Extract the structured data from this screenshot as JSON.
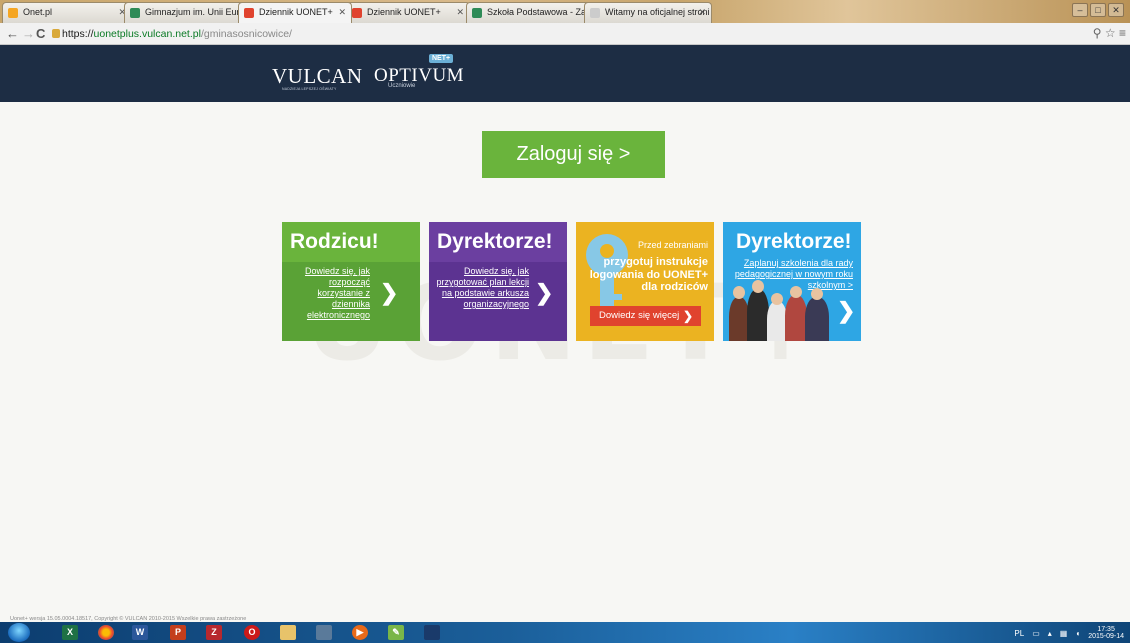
{
  "browser": {
    "tabs": [
      {
        "label": "Onet.pl",
        "favicon_color": "#f5a623"
      },
      {
        "label": "Gimnazjum im. Unii Europ",
        "favicon_color": "#2e8b57"
      },
      {
        "label": "Dziennik UONET+",
        "favicon_color": "#e0432e"
      },
      {
        "label": "Dziennik UONET+",
        "favicon_color": "#e0432e"
      },
      {
        "label": "Szkoła Podstawowa - Zap",
        "favicon_color": "#2e8b57"
      },
      {
        "label": "Witamy na oficjalnej stroni",
        "favicon_color": "#cccccc"
      }
    ],
    "url_scheme": "https://",
    "url_host": "uonetplus.vulcan.net.pl",
    "url_path": "/gminasosnicowice/"
  },
  "header": {
    "vulcan_logo": "VULCAN",
    "vulcan_tagline": "NADZIEJA LEPSZEJ OŚWIATY",
    "optivum_logo": "OPTIVUM",
    "optivum_badge": "NET+",
    "optivum_sub": "Uczniowie"
  },
  "login_button": "Zaloguj się >",
  "watermark": "UONET+",
  "tiles": {
    "rodzicu": {
      "title": "Rodzicu!",
      "link": "Dowiedz się, jak rozpocząć korzystanie z dziennika elektronicznego",
      "color": "#6ab43c"
    },
    "dyrektorze1": {
      "title": "Dyrektorze!",
      "link": "Dowiedz się, jak przygotować plan lekcji na podstawie arkusza organizacyjnego",
      "color": "#6b3fa0"
    },
    "zebranie": {
      "small": "Przed zebraniami",
      "bold": "przygotuj instrukcje logowania do UONET+ dla rodziców",
      "button": "Dowiedz się więcej",
      "color": "#ebb321"
    },
    "dyrektorze2": {
      "title": "Dyrektorze!",
      "link": "Zaplanuj szkolenia dla rady pedagogicznej w nowym roku szkolnym >",
      "color": "#2ea6e4"
    }
  },
  "footer": "Uonet+ wersja 15.05.0004.18517, Copyright © VULCAN 2010-2015 Wszelkie prawa zastrzeżone",
  "taskbar": {
    "lang": "PL",
    "time": "17:35",
    "date": "2015-09-14"
  }
}
